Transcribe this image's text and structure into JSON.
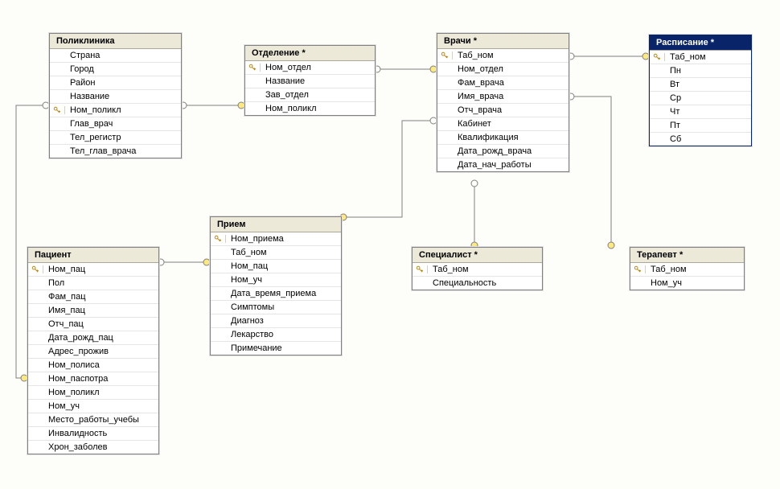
{
  "tables": {
    "poliklinika": {
      "title": "Поликлиника",
      "columns": [
        {
          "name": "Страна",
          "key": false
        },
        {
          "name": "Город",
          "key": false
        },
        {
          "name": "Район",
          "key": false
        },
        {
          "name": "Название",
          "key": false
        },
        {
          "name": "Ном_поликл",
          "key": true
        },
        {
          "name": "Глав_врач",
          "key": false
        },
        {
          "name": "Тел_регистр",
          "key": false
        },
        {
          "name": "Тел_глав_врача",
          "key": false
        }
      ]
    },
    "otdelenie": {
      "title": "Отделение *",
      "columns": [
        {
          "name": "Ном_отдел",
          "key": true
        },
        {
          "name": "Название",
          "key": false
        },
        {
          "name": "Зав_отдел",
          "key": false
        },
        {
          "name": "Ном_поликл",
          "key": false
        }
      ]
    },
    "vrachi": {
      "title": "Врачи *",
      "columns": [
        {
          "name": "Таб_ном",
          "key": true
        },
        {
          "name": "Ном_отдел",
          "key": false
        },
        {
          "name": "Фам_врача",
          "key": false
        },
        {
          "name": "Имя_врача",
          "key": false
        },
        {
          "name": "Отч_врача",
          "key": false
        },
        {
          "name": "Кабинет",
          "key": false
        },
        {
          "name": "Квалификация",
          "key": false
        },
        {
          "name": "Дата_рожд_врача",
          "key": false
        },
        {
          "name": "Дата_нач_работы",
          "key": false
        }
      ]
    },
    "raspisanie": {
      "title": "Расписание *",
      "selected": true,
      "columns": [
        {
          "name": "Таб_ном",
          "key": true
        },
        {
          "name": "Пн",
          "key": false
        },
        {
          "name": "Вт",
          "key": false
        },
        {
          "name": "Ср",
          "key": false
        },
        {
          "name": "Чт",
          "key": false
        },
        {
          "name": "Пт",
          "key": false
        },
        {
          "name": "Сб",
          "key": false
        }
      ]
    },
    "priem": {
      "title": "Прием",
      "columns": [
        {
          "name": "Ном_приема",
          "key": true
        },
        {
          "name": "Таб_ном",
          "key": false
        },
        {
          "name": "Ном_пац",
          "key": false
        },
        {
          "name": "Ном_уч",
          "key": false
        },
        {
          "name": "Дата_время_приема",
          "key": false
        },
        {
          "name": "Симптомы",
          "key": false
        },
        {
          "name": "Диагноз",
          "key": false
        },
        {
          "name": "Лекарство",
          "key": false
        },
        {
          "name": "Примечание",
          "key": false
        }
      ]
    },
    "patient": {
      "title": "Пациент",
      "columns": [
        {
          "name": "Ном_пац",
          "key": true
        },
        {
          "name": "Пол",
          "key": false
        },
        {
          "name": "Фам_пац",
          "key": false
        },
        {
          "name": "Имя_пац",
          "key": false
        },
        {
          "name": "Отч_пац",
          "key": false
        },
        {
          "name": "Дата_рожд_пац",
          "key": false
        },
        {
          "name": "Адрес_прожив",
          "key": false
        },
        {
          "name": "Ном_полиса",
          "key": false
        },
        {
          "name": "Ном_паспотра",
          "key": false
        },
        {
          "name": "Ном_поликл",
          "key": false
        },
        {
          "name": "Ном_уч",
          "key": false
        },
        {
          "name": "Место_работы_учебы",
          "key": false
        },
        {
          "name": "Инвалидность",
          "key": false
        },
        {
          "name": "Хрон_заболев",
          "key": false
        }
      ]
    },
    "specialist": {
      "title": "Специалист *",
      "columns": [
        {
          "name": "Таб_ном",
          "key": true
        },
        {
          "name": "Специальность",
          "key": false
        }
      ]
    },
    "terapevt": {
      "title": "Терапевт *",
      "columns": [
        {
          "name": "Таб_ном",
          "key": true
        },
        {
          "name": "Ном_уч",
          "key": false
        }
      ]
    }
  },
  "relationships": [
    {
      "from": "poliklinika",
      "to": "otdelenie"
    },
    {
      "from": "otdelenie",
      "to": "vrachi"
    },
    {
      "from": "vrachi",
      "to": "raspisanie"
    },
    {
      "from": "vrachi",
      "to": "specialist"
    },
    {
      "from": "vrachi",
      "to": "terapevt"
    },
    {
      "from": "poliklinika",
      "to": "patient"
    },
    {
      "from": "patient",
      "to": "priem"
    },
    {
      "from": "vrachi",
      "to": "priem"
    }
  ]
}
